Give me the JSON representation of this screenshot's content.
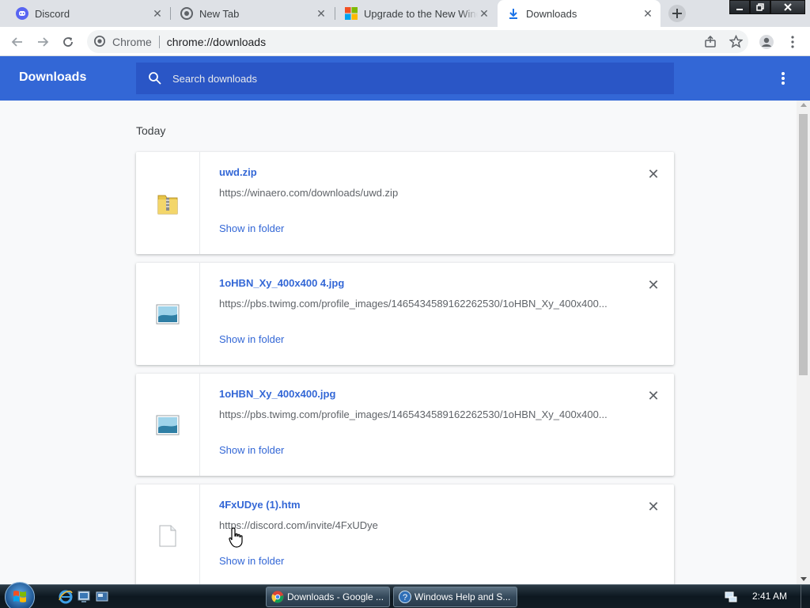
{
  "tabs": [
    {
      "title": "Discord",
      "icon": "discord-icon"
    },
    {
      "title": "New Tab",
      "icon": "chrome-icon"
    },
    {
      "title": "Upgrade to the New Windows",
      "icon": "windows-logo-icon"
    },
    {
      "title": "Downloads",
      "icon": "download-icon"
    }
  ],
  "toolbar": {
    "site_label": "Chrome",
    "url": "chrome://downloads"
  },
  "downloads_header": {
    "title": "Downloads",
    "search_placeholder": "Search downloads"
  },
  "section_label": "Today",
  "downloads": [
    {
      "name": "uwd.zip",
      "url": "https://winaero.com/downloads/uwd.zip",
      "action": "Show in folder",
      "file_icon": "zip-folder-icon"
    },
    {
      "name": "1oHBN_Xy_400x400 4.jpg",
      "url": "https://pbs.twimg.com/profile_images/1465434589162262530/1oHBN_Xy_400x400...",
      "action": "Show in folder",
      "file_icon": "image-file-icon"
    },
    {
      "name": "1oHBN_Xy_400x400.jpg",
      "url": "https://pbs.twimg.com/profile_images/1465434589162262530/1oHBN_Xy_400x400...",
      "action": "Show in folder",
      "file_icon": "image-file-icon"
    },
    {
      "name": "4FxUDye (1).htm",
      "url": "https://discord.com/invite/4FxUDye",
      "action": "Show in folder",
      "file_icon": "blank-file-icon"
    }
  ],
  "taskbar": {
    "tasks": [
      {
        "label": "Downloads - Google ...",
        "icon": "chrome-icon"
      },
      {
        "label": "Windows Help and S...",
        "icon": "help-icon"
      }
    ],
    "clock": "2:41 AM"
  },
  "colors": {
    "accent": "#3367d6",
    "search_bg": "#2a56c6",
    "page_bg": "#f8f9fa"
  }
}
